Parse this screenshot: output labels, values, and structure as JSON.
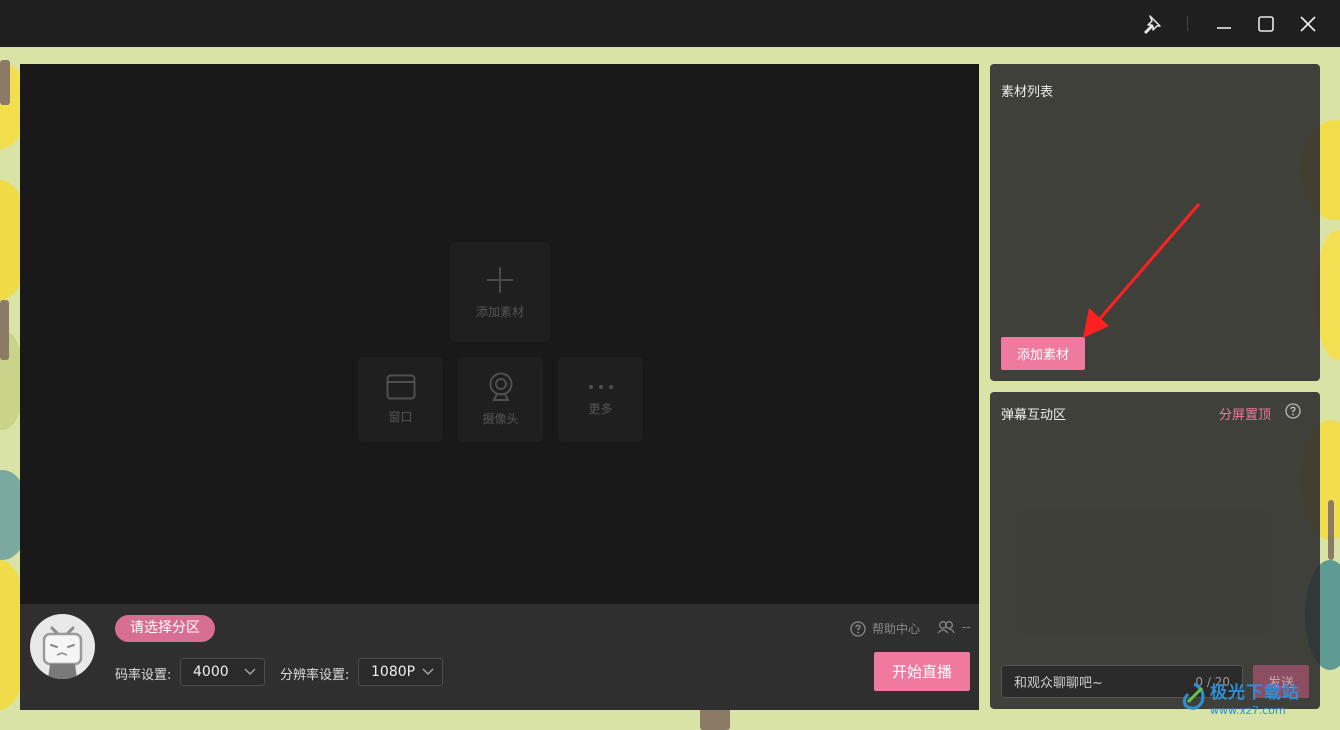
{
  "titlebar": {
    "icons": [
      "pin-icon",
      "minimize-icon",
      "maximize-icon",
      "close-icon"
    ]
  },
  "preview": {
    "add_material_label": "添加素材",
    "sources": [
      {
        "label": "窗口",
        "icon": "window-icon"
      },
      {
        "label": "摄像头",
        "icon": "camera-icon"
      },
      {
        "label": "更多",
        "icon": "more-icon"
      }
    ]
  },
  "bottombar": {
    "area_button": "请选择分区",
    "bitrate_label": "码率设置:",
    "bitrate_value": "4000",
    "resolution_label": "分辨率设置:",
    "resolution_value": "1080P",
    "help_label": "帮助中心",
    "viewer_count": "--",
    "start_button": "开始直播"
  },
  "material_panel": {
    "title": "素材列表",
    "add_button": "添加素材"
  },
  "chat_panel": {
    "title": "弹幕互动区",
    "split_top_label": "分屏置顶",
    "input_placeholder": "和观众聊聊吧~",
    "char_count": "0 / 20",
    "send_button": "发送"
  },
  "watermark": {
    "text": "极光下载站",
    "url": "www.xz7.com"
  },
  "colors": {
    "accent": "#f07a9f",
    "area_button": "#d86f92",
    "annotation_arrow": "#ff2020"
  }
}
